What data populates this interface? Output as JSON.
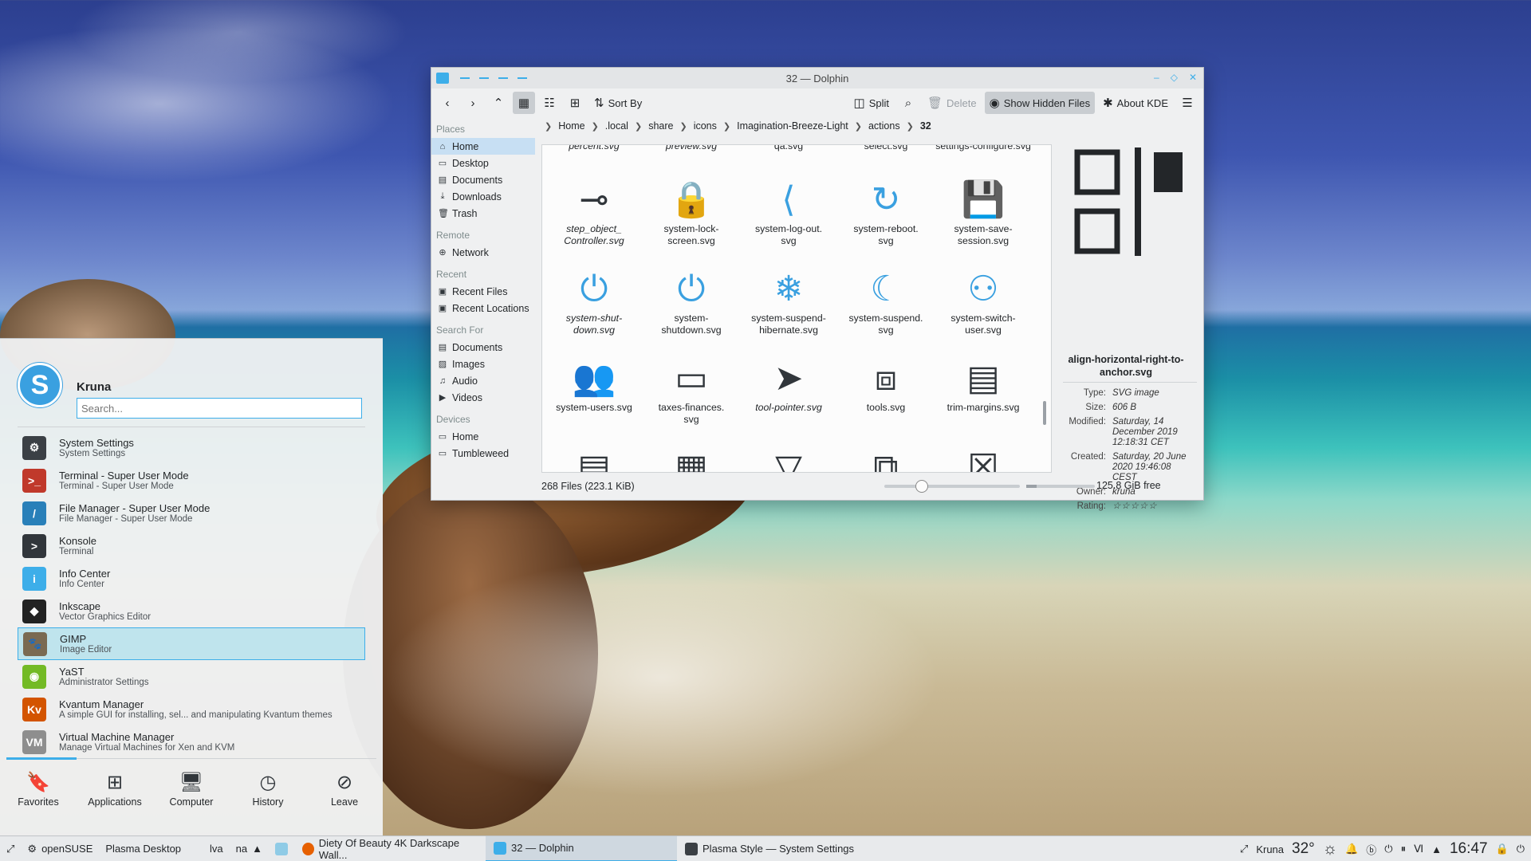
{
  "dolphin": {
    "title": "32 — Dolphin",
    "toolbar": {
      "sort_by": "Sort By",
      "split": "Split",
      "delete": "Delete",
      "show_hidden": "Show Hidden Files",
      "about_kde": "About KDE"
    },
    "places": {
      "places_header": "Places",
      "home": "Home",
      "desktop": "Desktop",
      "documents": "Documents",
      "downloads": "Downloads",
      "trash": "Trash",
      "remote_header": "Remote",
      "network": "Network",
      "recent_header": "Recent",
      "recent_files": "Recent Files",
      "recent_locations": "Recent Locations",
      "search_header": "Search For",
      "s_documents": "Documents",
      "s_images": "Images",
      "s_audio": "Audio",
      "s_videos": "Videos",
      "devices_header": "Devices",
      "d_home": "Home",
      "d_tumbleweed": "Tumbleweed"
    },
    "breadcrumb": [
      "Home",
      ".local",
      "share",
      "icons",
      "Imagination-Breeze-Light",
      "actions",
      "32"
    ],
    "partial_row": [
      "percent.svg",
      "preview.svg",
      "qa.svg",
      "select.svg",
      "settings-configure.svg"
    ],
    "files": [
      {
        "name": "step_object_\nController.svg",
        "icon": "slider-node-icon",
        "italic": true
      },
      {
        "name": "system-lock-\nscreen.svg",
        "icon": "lock-icon",
        "blue": true
      },
      {
        "name": "system-log-out.\nsvg",
        "icon": "log-out-icon",
        "blue": true
      },
      {
        "name": "system-reboot.\nsvg",
        "icon": "reboot-icon",
        "blue": true
      },
      {
        "name": "system-save-\nsession.svg",
        "icon": "floppy-icon"
      },
      {
        "name": "system-shut-\ndown.svg",
        "icon": "power-icon",
        "italic": true,
        "blue": true
      },
      {
        "name": "system-\nshutdown.svg",
        "icon": "power-icon",
        "blue": true
      },
      {
        "name": "system-suspend-\nhibernate.svg",
        "icon": "snowflake-icon",
        "blue": true
      },
      {
        "name": "system-suspend.\nsvg",
        "icon": "moon-icon",
        "blue": true
      },
      {
        "name": "system-switch-\nuser.svg",
        "icon": "switch-user-icon",
        "blue": true
      },
      {
        "name": "system-users.svg",
        "icon": "users-icon",
        "blue": true
      },
      {
        "name": "taxes-finances.\nsvg",
        "icon": "banknote-icon"
      },
      {
        "name": "tool-pointer.svg",
        "icon": "pointer-icon",
        "italic": true
      },
      {
        "name": "tools.svg",
        "icon": "toolbox-icon"
      },
      {
        "name": "trim-margins.svg",
        "icon": "document-icon"
      }
    ],
    "status": {
      "count": "268 Files (223.1 KiB)",
      "free": "125.8 GiB free",
      "zoom_fraction": 0.25,
      "used_fraction": 0.15
    },
    "info": {
      "filename": "align-horizontal-right-to-anchor.svg",
      "type_label": "Type:",
      "type": "SVG image",
      "size_label": "Size:",
      "size": "606 B",
      "modified_label": "Modified:",
      "modified": "Saturday, 14 December 2019 12:18:31 CET",
      "created_label": "Created:",
      "created": "Saturday, 20 June 2020 19:46:08 CEST",
      "owner_label": "Owner:",
      "owner": "kruna",
      "rating_label": "Rating:",
      "rating": "☆☆☆☆☆"
    }
  },
  "launcher": {
    "user": "Kruna",
    "search_placeholder": "Search...",
    "apps": [
      {
        "title": "System Settings",
        "subtitle": "System Settings",
        "color": "#3b4045",
        "glyph": "⚙",
        "icon": "settings-icon"
      },
      {
        "title": "Terminal - Super User Mode",
        "subtitle": "Terminal - Super User Mode",
        "color": "#c0392b",
        "glyph": ">_",
        "icon": "root-terminal-icon"
      },
      {
        "title": "File Manager - Super User Mode",
        "subtitle": "File Manager - Super User Mode",
        "color": "#2980b9",
        "glyph": "/",
        "icon": "folder-icon"
      },
      {
        "title": "Konsole",
        "subtitle": "Terminal",
        "color": "#31363b",
        "glyph": ">",
        "icon": "konsole-icon"
      },
      {
        "title": "Info Center",
        "subtitle": "Info Center",
        "color": "#3daee9",
        "glyph": "i",
        "icon": "info-icon"
      },
      {
        "title": "Inkscape",
        "subtitle": "Vector Graphics Editor",
        "color": "#222222",
        "glyph": "◆",
        "icon": "inkscape-icon"
      },
      {
        "title": "GIMP",
        "subtitle": "Image Editor",
        "color": "#7a6a52",
        "glyph": "🐾",
        "icon": "gimp-icon"
      },
      {
        "title": "YaST",
        "subtitle": "Administrator Settings",
        "color": "#73ba25",
        "glyph": "◉",
        "icon": "yast-icon"
      },
      {
        "title": "Kvantum Manager",
        "subtitle": "A simple GUI for installing, sel... and manipulating Kvantum themes",
        "color": "#d35400",
        "glyph": "Kv",
        "icon": "kvantum-icon"
      },
      {
        "title": "Virtual Machine Manager",
        "subtitle": "Manage Virtual Machines for Xen and KVM",
        "color": "#8e8e8e",
        "glyph": "VM",
        "icon": "vm-icon"
      }
    ],
    "selected_index": 6,
    "tabs": [
      "Favorites",
      "Applications",
      "Computer",
      "History",
      "Leave"
    ]
  },
  "panel": {
    "activity": "openSUSE",
    "desktop": "Plasma Desktop",
    "kb1": "lva",
    "kb2": "na",
    "tasks": [
      "Diety Of Beauty 4K Darkscape Wall...",
      "32 — Dolphin",
      "Plasma Style — System Settings"
    ],
    "user": "Kruna",
    "temperature": "32°",
    "clock": "16:47"
  }
}
